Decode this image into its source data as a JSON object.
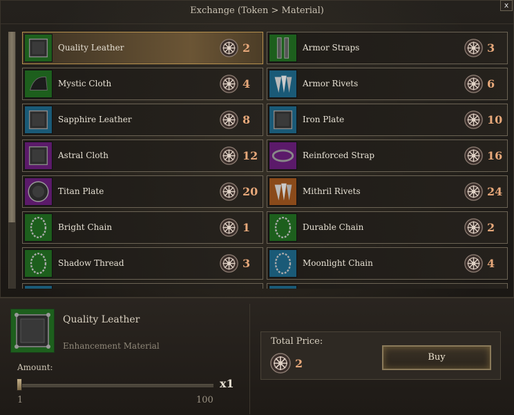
{
  "window": {
    "title": "Exchange (Token > Material)",
    "close_label": "x"
  },
  "items": [
    {
      "name": "Quality Leather",
      "price": "2",
      "icon": "quality-leather-icon",
      "bg": "#1d5f1d",
      "selected": true
    },
    {
      "name": "Armor Straps",
      "price": "3",
      "icon": "armor-straps-icon",
      "bg": "#1d5f1d",
      "selected": false
    },
    {
      "name": "Mystic Cloth",
      "price": "4",
      "icon": "mystic-cloth-icon",
      "bg": "#1d5f1d",
      "selected": false
    },
    {
      "name": "Armor Rivets",
      "price": "6",
      "icon": "armor-rivets-icon",
      "bg": "#1a5a77",
      "selected": false
    },
    {
      "name": "Sapphire Leather",
      "price": "8",
      "icon": "sapphire-leather-icon",
      "bg": "#1a5a77",
      "selected": false
    },
    {
      "name": "Iron Plate",
      "price": "10",
      "icon": "iron-plate-icon",
      "bg": "#1a5a77",
      "selected": false
    },
    {
      "name": "Astral Cloth",
      "price": "12",
      "icon": "astral-cloth-icon",
      "bg": "#5b1a6a",
      "selected": false
    },
    {
      "name": "Reinforced Strap",
      "price": "16",
      "icon": "reinforced-strap-icon",
      "bg": "#5b1a6a",
      "selected": false
    },
    {
      "name": "Titan Plate",
      "price": "20",
      "icon": "titan-plate-icon",
      "bg": "#5b1a6a",
      "selected": false
    },
    {
      "name": "Mithril Rivets",
      "price": "24",
      "icon": "mithril-rivets-icon",
      "bg": "#8a4a1a",
      "selected": false
    },
    {
      "name": "Bright Chain",
      "price": "1",
      "icon": "bright-chain-icon",
      "bg": "#1d5f1d",
      "selected": false
    },
    {
      "name": "Durable Chain",
      "price": "2",
      "icon": "durable-chain-icon",
      "bg": "#1d5f1d",
      "selected": false
    },
    {
      "name": "Shadow Thread",
      "price": "3",
      "icon": "shadow-thread-icon",
      "bg": "#1d5f1d",
      "selected": false
    },
    {
      "name": "Moonlight Chain",
      "price": "4",
      "icon": "moonlight-chain-icon",
      "bg": "#1a5a77",
      "selected": false
    },
    {
      "name": "",
      "price": "",
      "icon": "partial-item-icon",
      "bg": "#1a5a77",
      "selected": false
    },
    {
      "name": "",
      "price": "",
      "icon": "partial-item-icon",
      "bg": "#1a5a77",
      "selected": false
    }
  ],
  "selected": {
    "name": "Quality Leather",
    "type": "Enhancement Material",
    "icon": "quality-leather-icon"
  },
  "amount": {
    "label": "Amount:",
    "value": "x1",
    "min": "1",
    "max": "100",
    "level": 0
  },
  "total": {
    "label": "Total Price:",
    "value": "2",
    "currency_icon": "token-coin-icon"
  },
  "buy_label": "Buy",
  "colors": {
    "price": "#e7a87a",
    "selected_border": "#b8924f",
    "panel_border": "#6b6354"
  }
}
